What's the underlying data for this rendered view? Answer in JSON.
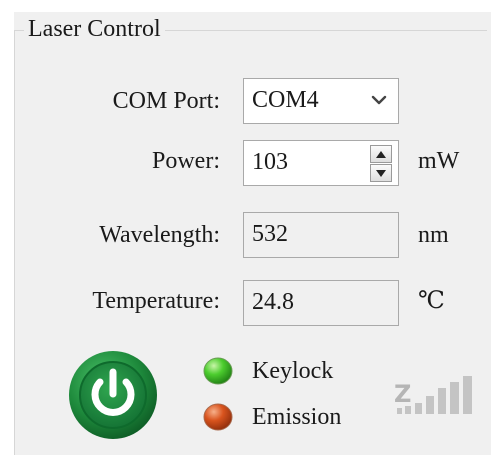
{
  "group": {
    "title": "Laser Control"
  },
  "com_port": {
    "label": "COM Port:",
    "value": "COM4"
  },
  "power": {
    "label": "Power:",
    "value": "103",
    "unit": "mW"
  },
  "wavelength": {
    "label": "Wavelength:",
    "value": "532",
    "unit": "nm"
  },
  "temperature": {
    "label": "Temperature:",
    "value": "24.8",
    "unit": "℃"
  },
  "status": {
    "keylock": {
      "label": "Keylock",
      "color": "#3fbf2e"
    },
    "emission": {
      "label": "Emission",
      "color": "#d9541e"
    }
  },
  "icons": {
    "power": "power-icon",
    "signal": "signal-strength-icon"
  },
  "colors": {
    "panel_bg": "#f0f0f0",
    "power_button_green": "#1e8a3c"
  }
}
